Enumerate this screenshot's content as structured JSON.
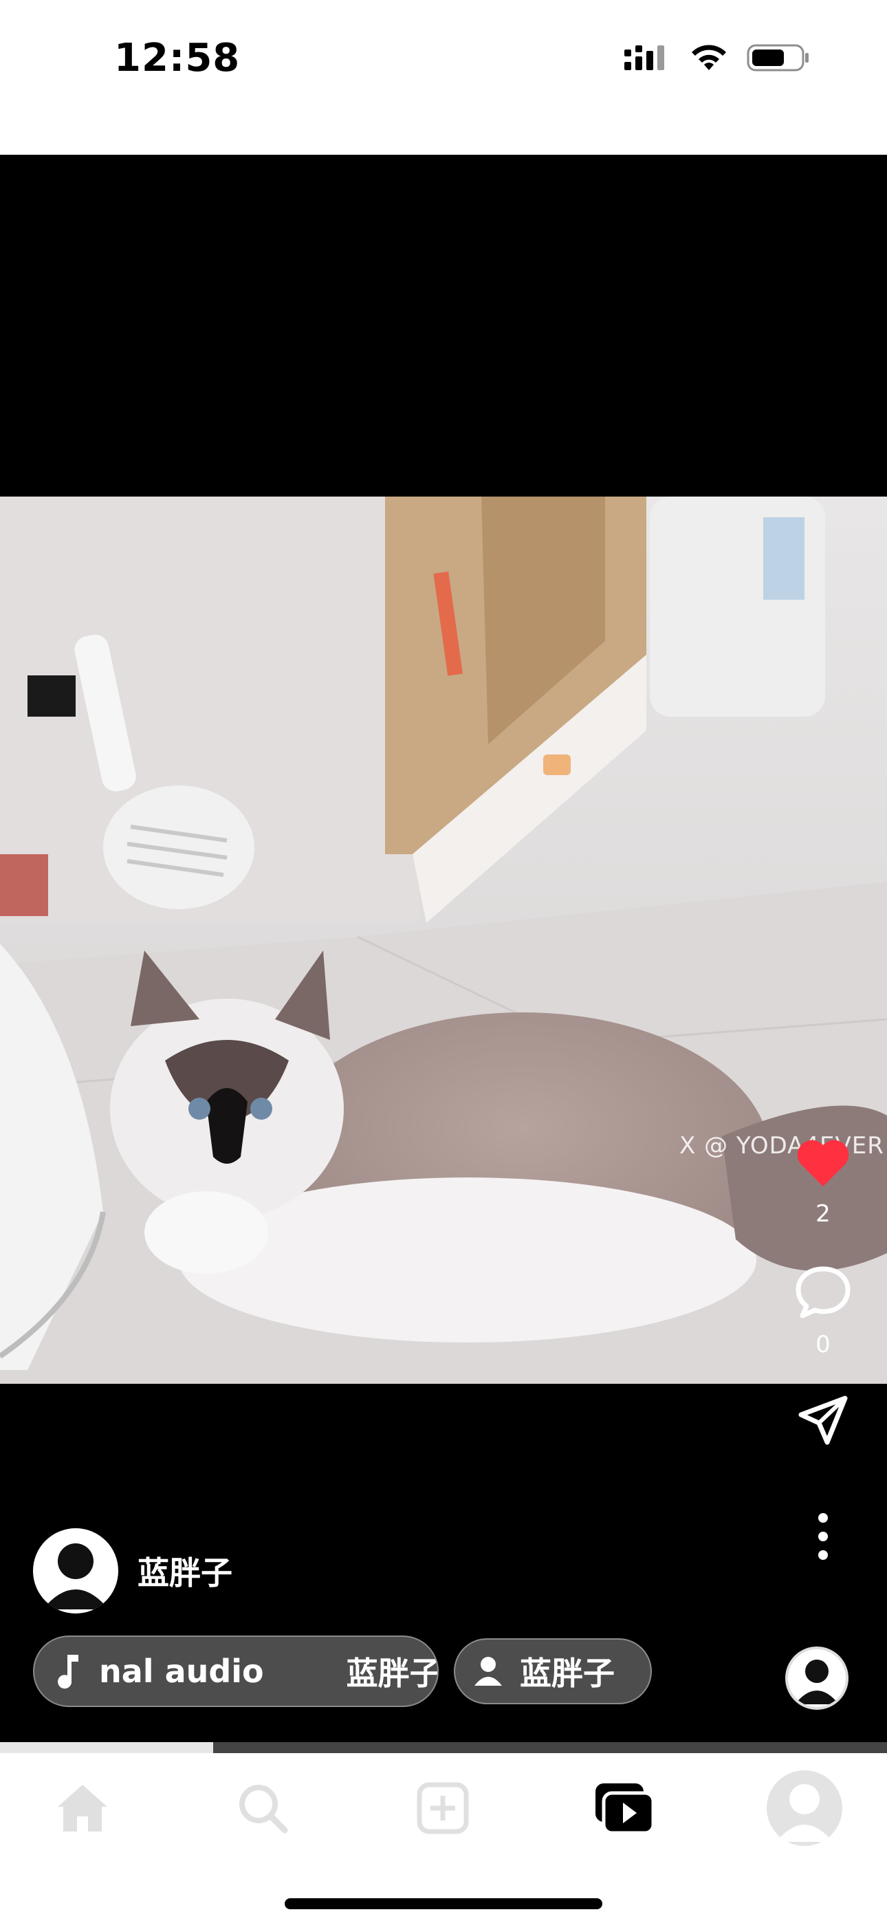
{
  "status": {
    "time": "12:58"
  },
  "video": {
    "watermark": "X @ YODA4EVER",
    "like_count": "2",
    "comment_count": "0",
    "progress": 0.24
  },
  "author": {
    "name": "蓝胖子"
  },
  "audio_chip": {
    "text": "nal audio",
    "author": "蓝胖子"
  },
  "user_chip": {
    "label": "蓝胖子"
  },
  "colors": {
    "like": "#ff3040",
    "progress_fill": "#e6e6e6",
    "progress_track": "#444444"
  },
  "tab_bar": {
    "items": [
      "home-icon",
      "search-icon",
      "create-icon",
      "reels-icon",
      "profile-icon"
    ],
    "active": "reels-icon"
  }
}
